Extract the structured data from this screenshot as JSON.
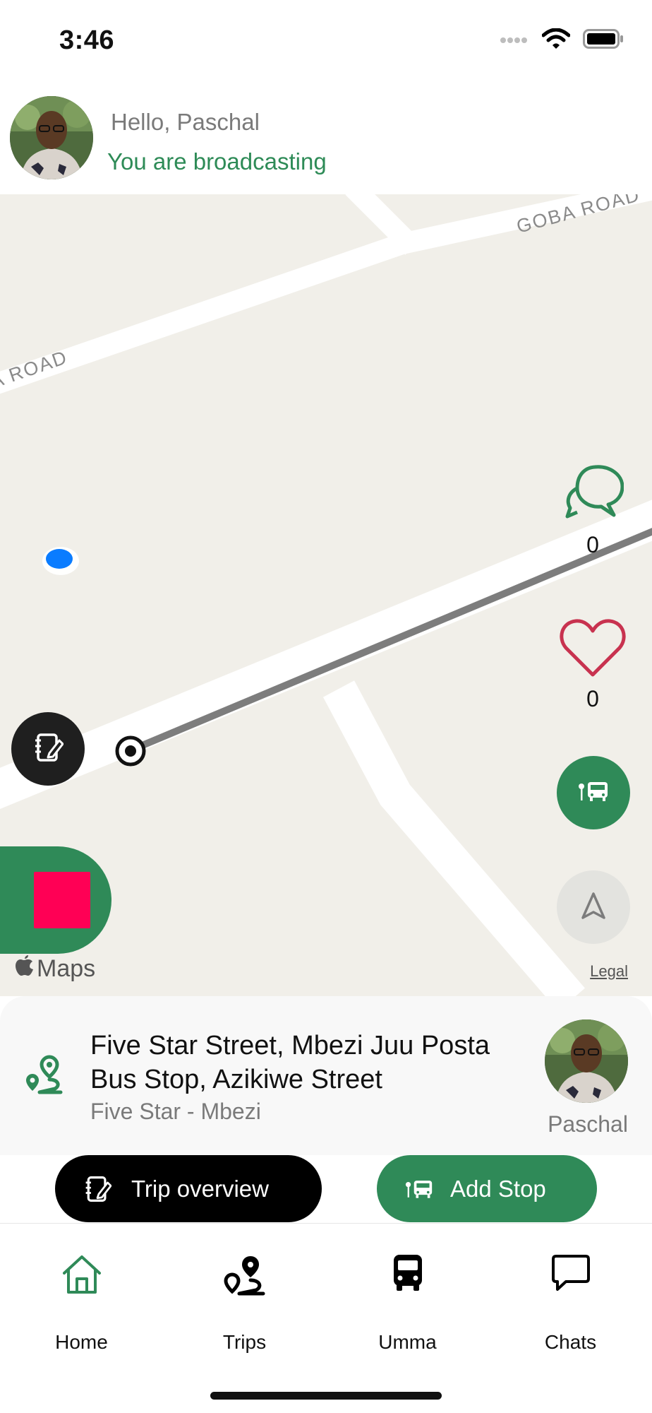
{
  "status_bar": {
    "time": "3:46",
    "icons": [
      "cellular-icon",
      "wifi-icon",
      "battery-icon"
    ]
  },
  "header": {
    "greeting": "Hello, Paschal",
    "status": "You are broadcasting",
    "status_color": "#2e8b57"
  },
  "map": {
    "road_labels": [
      "GOBA ROAD",
      "A ROAD"
    ],
    "comment_count": "0",
    "like_count": "0",
    "attribution": "Maps",
    "legal": "Legal",
    "colors": {
      "background": "#f1efe9",
      "route": "#7d7d7d",
      "user_location": "#0a7cff",
      "stop_button": "#ff0055",
      "accent": "#2f8a58"
    }
  },
  "trip": {
    "route": "Five Star Street, Mbezi Juu Posta Bus Stop, Azikiwe Street",
    "subtitle": "Five Star - Mbezi",
    "driver_name": "Paschal"
  },
  "actions": {
    "trip_overview": "Trip overview",
    "add_stop": "Add Stop"
  },
  "tabs": [
    {
      "label": "Home",
      "icon": "home-icon",
      "active": true
    },
    {
      "label": "Trips",
      "icon": "route-icon",
      "active": false
    },
    {
      "label": "Umma",
      "icon": "bus-icon",
      "active": false
    },
    {
      "label": "Chats",
      "icon": "chat-icon",
      "active": false
    }
  ]
}
